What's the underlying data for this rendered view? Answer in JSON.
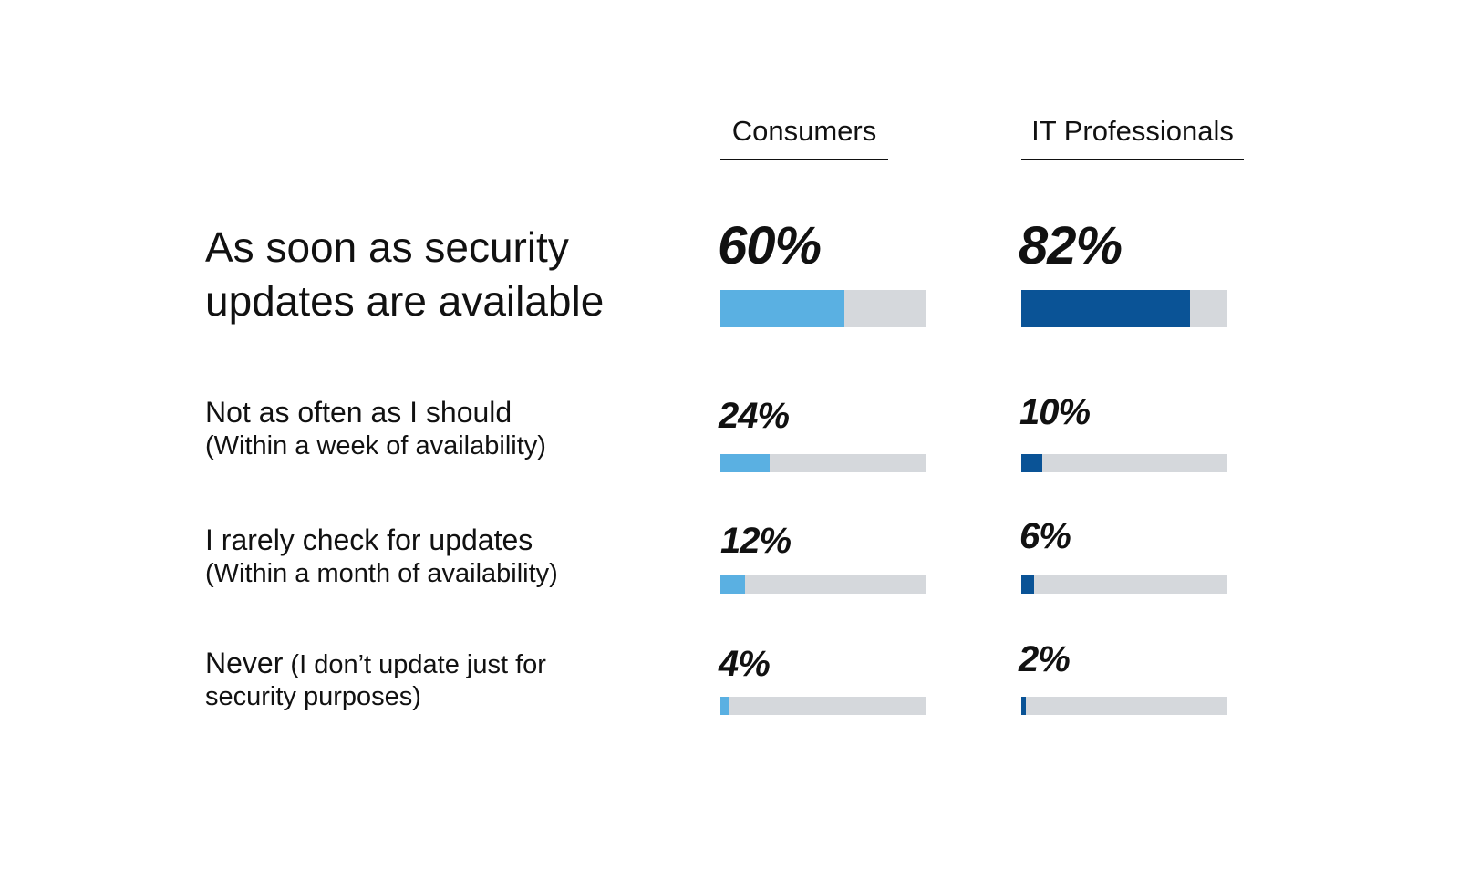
{
  "colors": {
    "consumers": "#5ab0e2",
    "it_professionals": "#0a5396",
    "track": "#d5d8dc"
  },
  "chart_data": {
    "type": "bar",
    "title": "",
    "xlabel": "",
    "ylabel": "",
    "ylim": [
      0,
      100
    ],
    "categories": [
      "As soon as security updates are available",
      "Not as often as I should (Within a week of availability)",
      "I rarely check for updates (Within a month of availability)",
      "Never (I don't update just for security purposes)"
    ],
    "series": [
      {
        "name": "Consumers",
        "values": [
          60,
          24,
          12,
          4
        ]
      },
      {
        "name": "IT Professionals",
        "values": [
          82,
          10,
          6,
          2
        ]
      }
    ],
    "legend": "top",
    "grid": false
  },
  "headers": {
    "consumers": "Consumers",
    "it_professionals": "IT Professionals"
  },
  "rows": [
    {
      "main": "As soon as security updates are available",
      "sub": "",
      "consumers_label": "60%",
      "it_label": "82%"
    },
    {
      "main": "Not as often as I should",
      "sub": "(Within a week of availability)",
      "consumers_label": "24%",
      "it_label": "10%"
    },
    {
      "main": "I rarely check for updates",
      "sub": "(Within a month of availability)",
      "consumers_label": "12%",
      "it_label": "6%"
    },
    {
      "main": "Never",
      "sub": " (I don’t update just for security purposes)",
      "consumers_label": "4%",
      "it_label": "2%"
    }
  ]
}
